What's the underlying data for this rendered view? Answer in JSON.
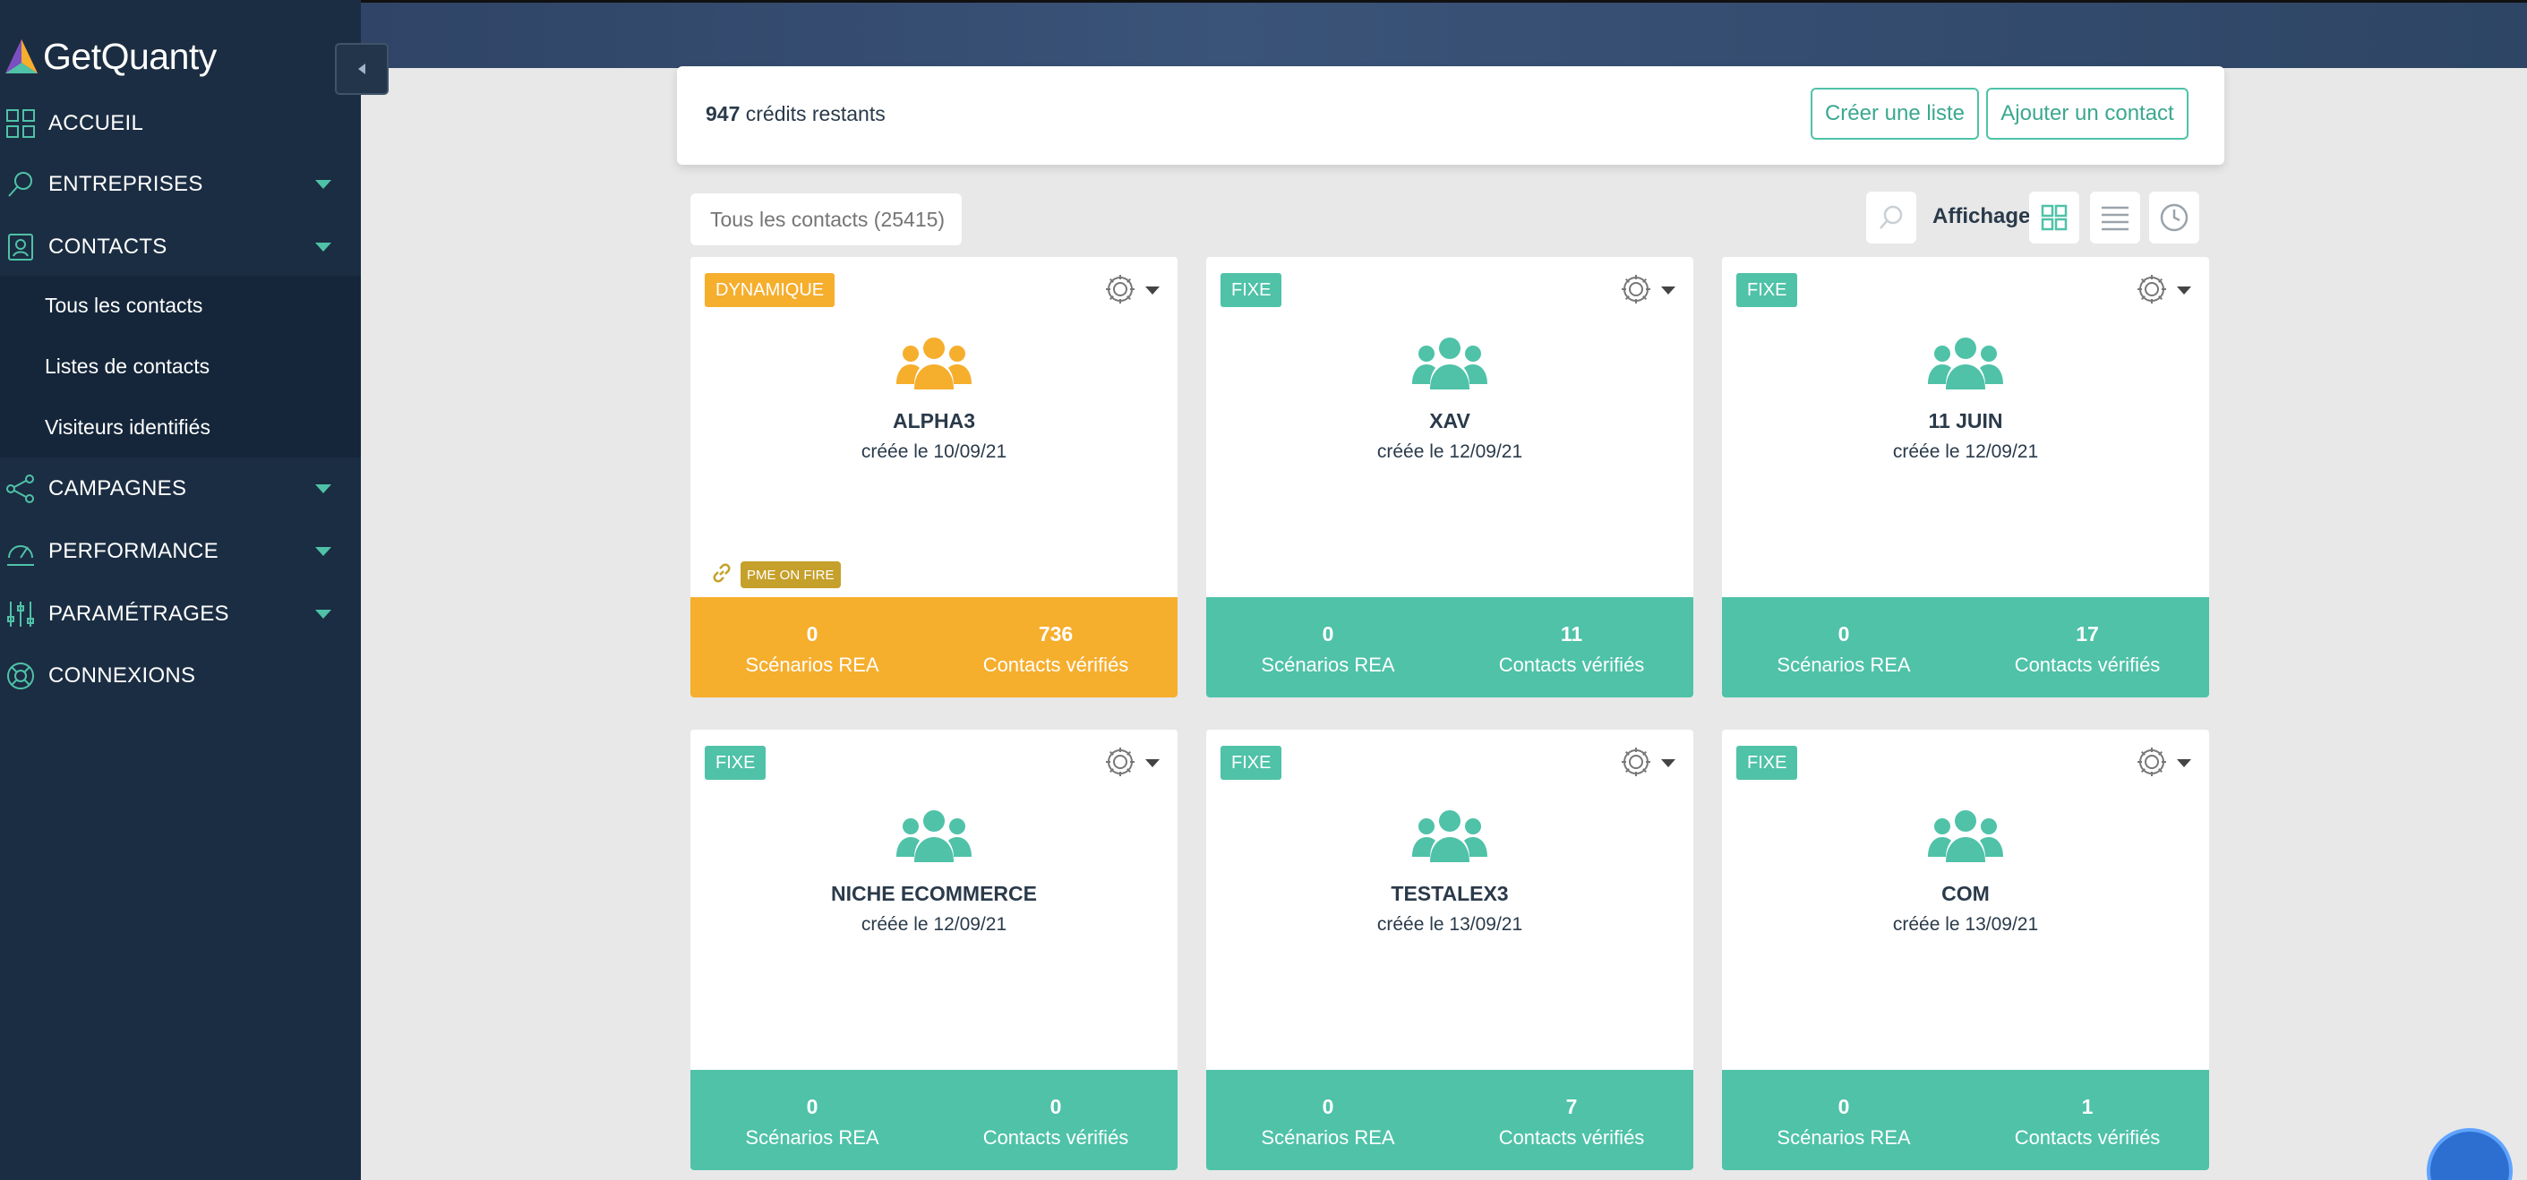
{
  "sidebar": {
    "logo_text": "GetQuanty",
    "nav": [
      {
        "label": "ACCUEIL",
        "icon": "dashboard-icon"
      },
      {
        "label": "ENTREPRISES",
        "icon": "rocket-icon"
      },
      {
        "label": "CONTACTS",
        "icon": "contact-card-icon"
      },
      {
        "label": "CAMPAGNES",
        "icon": "share-nodes-icon"
      },
      {
        "label": "PERFORMANCE",
        "icon": "gauge-icon"
      },
      {
        "label": "PARAMÉTRAGES",
        "icon": "sliders-icon"
      },
      {
        "label": "CONNEXIONS",
        "icon": "lifebuoy-icon"
      }
    ],
    "contacts_sub": [
      "Tous les contacts",
      "Listes de contacts",
      "Visiteurs identifiés"
    ]
  },
  "credits": {
    "count": "947",
    "label": "crédits restants",
    "create_list": "Créer une liste",
    "add_contact": "Ajouter un contact"
  },
  "toolbar": {
    "search_placeholder": "Tous les contacts (25415)",
    "affichage": "Affichage"
  },
  "colors": {
    "dynamic": "#f6ae2d",
    "fixed": "#4fc2a8",
    "sidebar": "#1b2d42",
    "tag": "#c5a02a"
  },
  "stat_labels": {
    "scenarios": "Scénarios REA",
    "contacts": "Contacts vérifiés"
  },
  "cards": [
    {
      "badge": "DYNAMIQUE",
      "type": "dynamic",
      "title": "ALPHA3",
      "date": "créée le 10/09/21",
      "scenarios": "0",
      "contacts": "736",
      "tag": "PME ON FIRE"
    },
    {
      "badge": "FIXE",
      "type": "fixed",
      "title": "XAV",
      "date": "créée le 12/09/21",
      "scenarios": "0",
      "contacts": "11"
    },
    {
      "badge": "FIXE",
      "type": "fixed",
      "title": "11 JUIN",
      "date": "créée le 12/09/21",
      "scenarios": "0",
      "contacts": "17"
    },
    {
      "badge": "FIXE",
      "type": "fixed",
      "title": "NICHE ECOMMERCE",
      "date": "créée le 12/09/21",
      "scenarios": "0",
      "contacts": "0"
    },
    {
      "badge": "FIXE",
      "type": "fixed",
      "title": "TESTALEX3",
      "date": "créée le 13/09/21",
      "scenarios": "0",
      "contacts": "7"
    },
    {
      "badge": "FIXE",
      "type": "fixed",
      "title": "COM",
      "date": "créée le 13/09/21",
      "scenarios": "0",
      "contacts": "1"
    }
  ]
}
